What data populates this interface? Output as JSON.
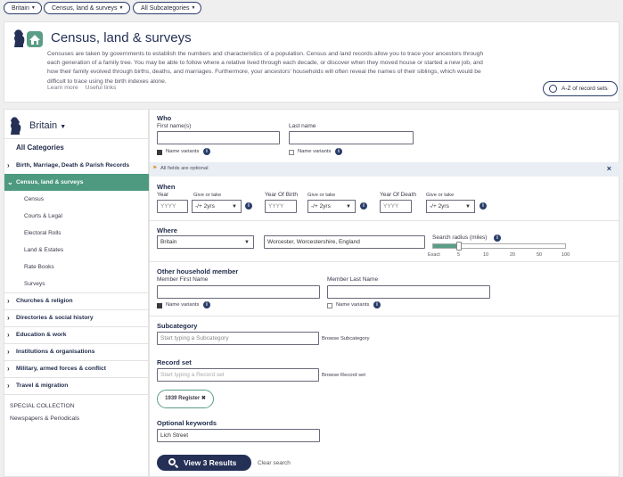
{
  "filters": {
    "country": "Britain",
    "category": "Census, land & surveys",
    "subcategory": "All Subcategories"
  },
  "header": {
    "title": "Census, land & surveys",
    "description": "Censuses are taken by governments to establish the numbers and characteristics of a population. Census and land records allow you to trace your ancestors through each generation of a family tree. You may be able to follow where a relative lived through each decade, or discover when they moved house or started a new job, and how their family evolved through births, deaths, and marriages. Furthermore, your ancestors' households will often reveal the names of their siblings, which would be difficult to trace using the birth indexes alone.",
    "link_learn": "Learn more",
    "link_useful": "Useful links",
    "az_button": "A-Z of record sets"
  },
  "sidebar": {
    "country": "Britain",
    "all_categories": "All Categories",
    "items": [
      {
        "label": "Birth, Marriage, Death & Parish Records"
      },
      {
        "label": "Census, land & surveys"
      },
      {
        "label": "Churches & religion"
      },
      {
        "label": "Directories & social history"
      },
      {
        "label": "Education & work"
      },
      {
        "label": "Institutions & organisations"
      },
      {
        "label": "Military, armed forces & conflict"
      },
      {
        "label": "Travel & migration"
      }
    ],
    "subitems": [
      "Census",
      "Courts & Legal",
      "Electoral Rolls",
      "Land & Estates",
      "Rate Books",
      "Surveys"
    ],
    "special_collection": "SPECIAL COLLECTION",
    "newspapers": "Newspapers & Periodicals"
  },
  "who": {
    "title": "Who",
    "first_name_label": "First name(s)",
    "last_name_label": "Last name",
    "first_name_value": "",
    "last_name_value": "",
    "name_variants": "Name variants",
    "first_variants_checked": true,
    "last_variants_checked": false
  },
  "notice": "All fields are optional",
  "when": {
    "title": "When",
    "year_label": "Year",
    "year_placeholder": "YYYY",
    "birth_label": "Year Of Birth",
    "death_label": "Year Of Death",
    "give_or_take": "Give or take",
    "range_value": "-/+ 2yrs"
  },
  "where": {
    "title": "Where",
    "country_value": "Britain",
    "location_value": "Worcester, Worcestershire, England",
    "radius_label": "Search radius (miles)",
    "radius_ticks": [
      "Exact",
      "5",
      "10",
      "20",
      "50",
      "100"
    ],
    "radius_selected": "5"
  },
  "household": {
    "title": "Other household member",
    "first_label": "Member First Name",
    "last_label": "Member Last Name",
    "name_variants": "Name variants",
    "first_variants_checked": true,
    "last_variants_checked": false
  },
  "subcategory": {
    "title": "Subcategory",
    "placeholder": "Start typing a Subcategory",
    "browse": "Browse Subcategory"
  },
  "record_set": {
    "title": "Record set",
    "placeholder": "Start typing a Record set",
    "browse": "Browse Record set",
    "selected_tag": "1939 Register ✖"
  },
  "keywords": {
    "title": "Optional keywords",
    "value": "Lich Street"
  },
  "actions": {
    "results": "View 3 Results",
    "clear": "Clear search"
  },
  "colors": {
    "navy": "#243056",
    "green": "#4d9a80"
  }
}
